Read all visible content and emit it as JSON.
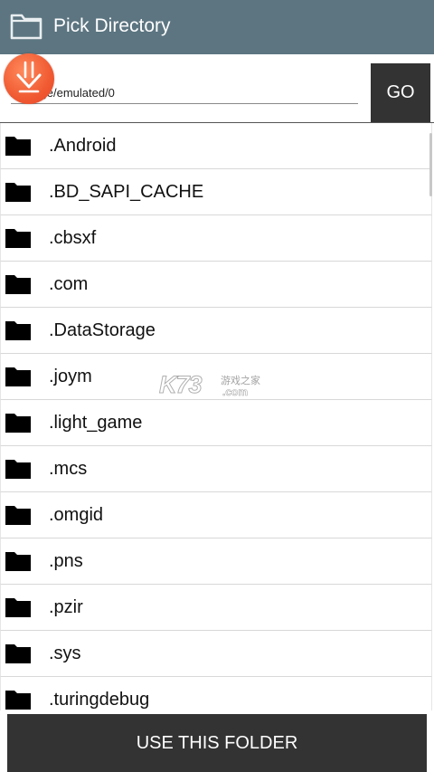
{
  "titlebar": {
    "title": "Pick Directory",
    "icon": "folder-outline-icon",
    "background": "#5c7581"
  },
  "path": {
    "value": "/storage/emulated/0",
    "go_label": "GO"
  },
  "badge": {
    "icon": "download-arrow-icon",
    "color": "#f05a32"
  },
  "directories": [
    {
      "label": ".Android"
    },
    {
      "label": ".BD_SAPI_CACHE"
    },
    {
      "label": ".cbsxf"
    },
    {
      "label": ".com"
    },
    {
      "label": ".DataStorage"
    },
    {
      "label": ".joym"
    },
    {
      "label": ".light_game"
    },
    {
      "label": ".mcs"
    },
    {
      "label": ".omgid"
    },
    {
      "label": ".pns"
    },
    {
      "label": ".pzir"
    },
    {
      "label": ".sys"
    },
    {
      "label": ".turingdebug"
    }
  ],
  "watermark": {
    "brand": "K73",
    "tagline": "游戏之家",
    "domain": ".com"
  },
  "footer": {
    "use_folder_label": "USE THIS FOLDER"
  }
}
